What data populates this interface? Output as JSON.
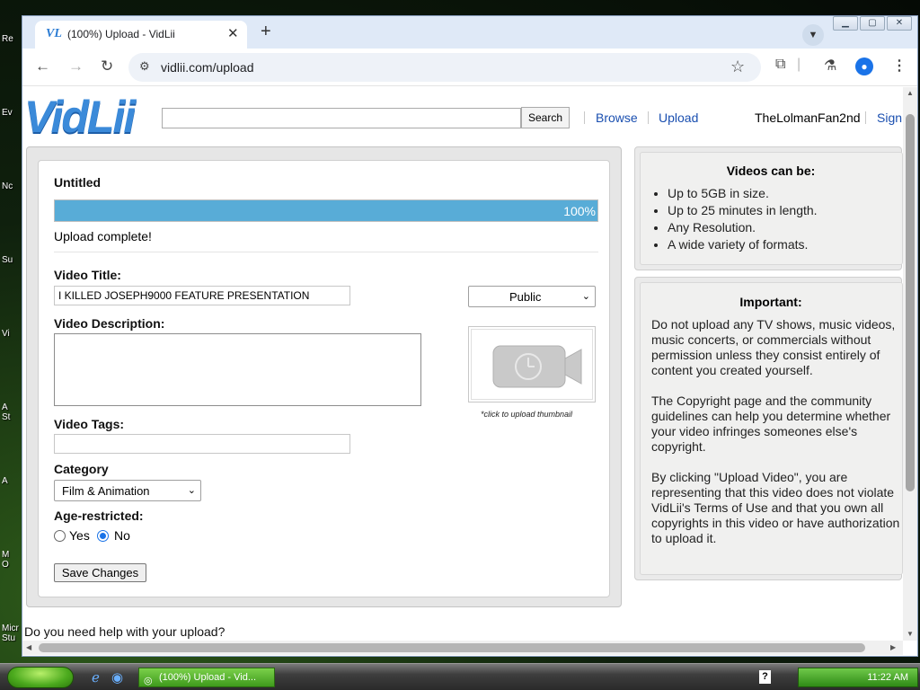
{
  "desktop": {
    "icon_labels": [
      "Re",
      "Ev",
      "Nc",
      "Su",
      "Vi",
      "A\nSt",
      "A",
      "M\nO",
      "Micr\nStu"
    ]
  },
  "browser": {
    "tab_title": "(100%) Upload - VidLii",
    "tab_favicon": "VL",
    "url": "vidlii.com/upload",
    "icons": {
      "back": "arrow-left-icon",
      "forward": "arrow-right-icon",
      "reload": "reload-icon",
      "site_info": "tune-icon",
      "bookmark": "star-icon",
      "extensions": "puzzle-icon",
      "labs": "flask-icon",
      "profile": "person-icon",
      "menu": "more-vert-icon"
    }
  },
  "site": {
    "logo": "VidLii",
    "search_button": "Search",
    "nav": {
      "browse": "Browse",
      "upload": "Upload",
      "username": "TheLolmanFan2nd",
      "sign": "Sign"
    },
    "accent_color": "#3b8ad9",
    "link_color": "#1a4fb0"
  },
  "upload_form": {
    "file_name": "Untitled",
    "progress_percent": 100,
    "progress_label": "100%",
    "progress_color": "#58acd7",
    "status": "Upload complete!",
    "video_title_label": "Video Title:",
    "video_title_value": "I KILLED JOSEPH9000 FEATURE PRESENTATION",
    "privacy_value": "Public",
    "description_label": "Video Description:",
    "description_value": "",
    "thumbnail_caption": "*click to upload thumbnail",
    "tags_label": "Video Tags:",
    "tags_value": "",
    "category_label": "Category",
    "category_value": "Film & Animation",
    "age_label": "Age-restricted:",
    "age_yes": "Yes",
    "age_no": "No",
    "age_selected": "No",
    "save_button": "Save Changes",
    "help_text": "Do you need help with your upload?"
  },
  "sidebar": {
    "videos_title": "Videos can be:",
    "videos_items": [
      "Up to 5GB in size.",
      "Up to 25 minutes in length.",
      "Any Resolution.",
      "A wide variety of formats."
    ],
    "important_title": "Important:",
    "important_paragraphs": [
      "Do not upload any TV shows, music videos, music concerts, or commercials without permission unless they consist entirely of content you created yourself.",
      "The Copyright page and the community guidelines can help you determine whether your video infringes someones else's copyright.",
      "By clicking \"Upload Video\", you are representing that this video does not violate VidLii's Terms of Use and that you own all copyrights in this video or have authorization to upload it."
    ]
  },
  "taskbar": {
    "task_title": "(100%) Upload - Vid...",
    "clock": "11:22 AM",
    "help_icon": "?"
  }
}
